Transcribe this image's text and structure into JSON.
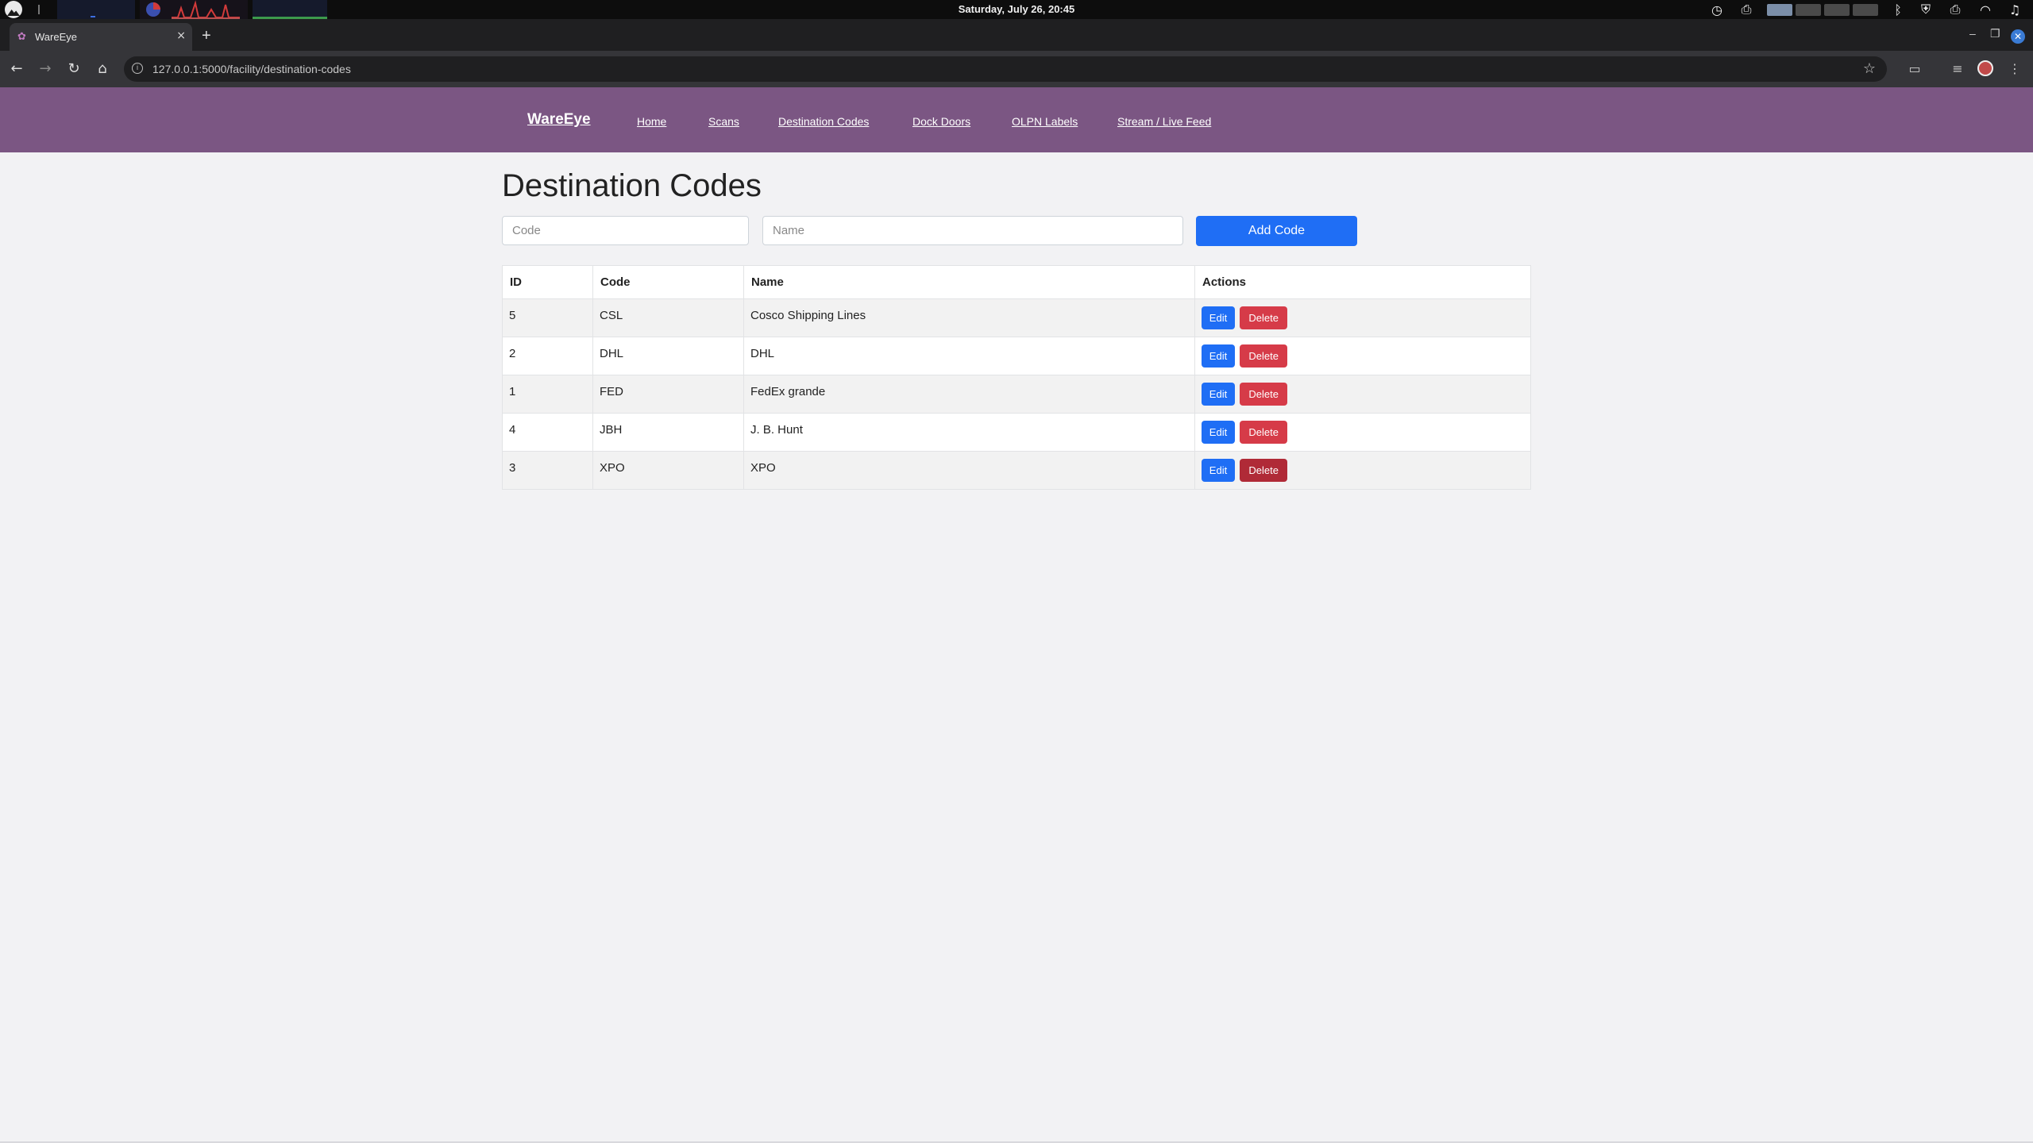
{
  "os": {
    "clock": "Saturday, July 26, 20:45",
    "tray_icons": [
      "clock-icon",
      "printer-icon",
      "printer-icon",
      "bluetooth-icon",
      "shield-icon",
      "wifi-icon",
      "music-icon"
    ]
  },
  "browser": {
    "tab_title": "WareEye",
    "url": "127.0.0.1:5000/facility/destination-codes",
    "new_tab_label": "+",
    "tab_close_label": "×"
  },
  "nav": {
    "brand": "WareEye",
    "links": [
      "Home",
      "Scans",
      "Destination Codes",
      "Dock Doors",
      "OLPN Labels",
      "Stream / Live Feed"
    ]
  },
  "page": {
    "title": "Destination Codes",
    "form": {
      "code_placeholder": "Code",
      "name_placeholder": "Name",
      "add_label": "Add Code"
    }
  },
  "table": {
    "headers": [
      "ID",
      "Code",
      "Name",
      "Actions"
    ],
    "rows": [
      {
        "id": "5",
        "code": "CSL",
        "name": "Cosco Shipping Lines"
      },
      {
        "id": "2",
        "code": "DHL",
        "name": "DHL"
      },
      {
        "id": "1",
        "code": "FED",
        "name": "FedEx grande"
      },
      {
        "id": "4",
        "code": "JBH",
        "name": "J. B. Hunt"
      },
      {
        "id": "3",
        "code": "XPO",
        "name": "XPO"
      }
    ],
    "edit_label": "Edit",
    "delete_label": "Delete"
  },
  "colors": {
    "nav_bg": "#7b5683",
    "primary": "#1f6ef5",
    "danger": "#d63b48",
    "page_bg": "#f2f2f4"
  }
}
